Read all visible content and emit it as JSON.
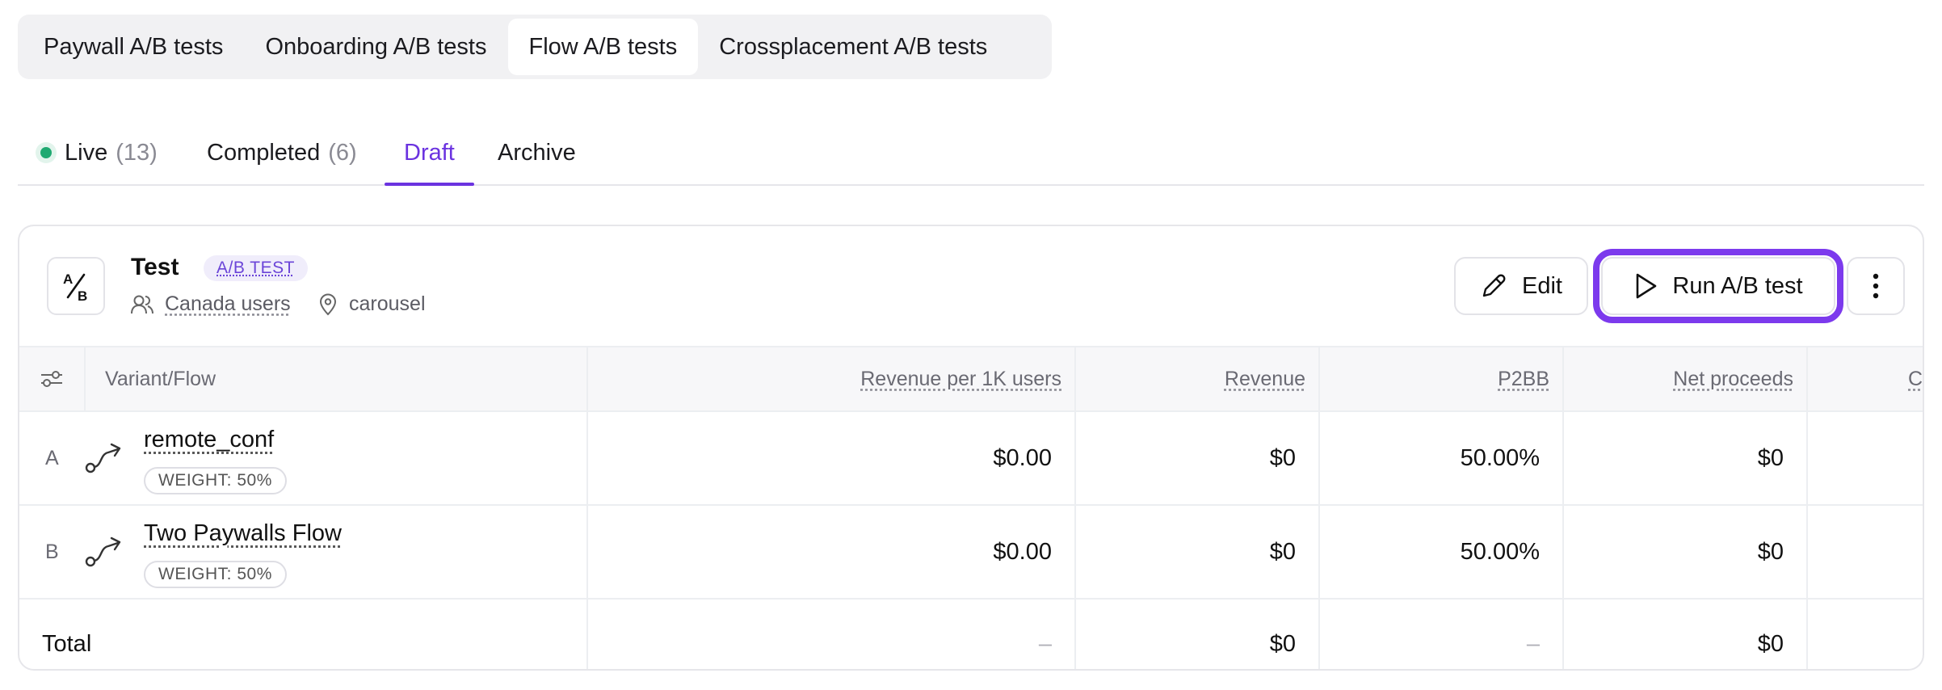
{
  "top_tabs": [
    {
      "label": "Paywall A/B tests"
    },
    {
      "label": "Onboarding A/B tests"
    },
    {
      "label": "Flow A/B tests",
      "active": true
    },
    {
      "label": "Crossplacement A/B tests"
    }
  ],
  "status_tabs": {
    "live": {
      "label": "Live",
      "count": "(13)"
    },
    "completed": {
      "label": "Completed",
      "count": "(6)"
    },
    "draft": {
      "label": "Draft"
    },
    "archive": {
      "label": "Archive"
    }
  },
  "test": {
    "badge_top": "A",
    "badge_bottom": "B",
    "title": "Test",
    "tag": "A/B TEST",
    "audience": "Canada users",
    "placement": "carousel",
    "edit_label": "Edit",
    "run_label": "Run A/B test"
  },
  "table": {
    "headers": {
      "variant": "Variant/Flow",
      "revenue_per_1k": "Revenue per 1K users",
      "revenue": "Revenue",
      "p2bb": "P2BB",
      "net_proceeds": "Net proceeds",
      "cr": "CR"
    },
    "rows": [
      {
        "letter": "A",
        "name": "remote_conf",
        "weight": "WEIGHT: 50%",
        "revenue_per_1k": "$0.00",
        "revenue": "$0",
        "p2bb": "50.00%",
        "net_proceeds": "$0"
      },
      {
        "letter": "B",
        "name": "Two Paywalls Flow",
        "weight": "WEIGHT: 50%",
        "revenue_per_1k": "$0.00",
        "revenue": "$0",
        "p2bb": "50.00%",
        "net_proceeds": "$0"
      }
    ],
    "total": {
      "label": "Total",
      "revenue_per_1k": "–",
      "revenue": "$0",
      "p2bb": "–",
      "net_proceeds": "$0"
    }
  },
  "colors": {
    "accent": "#6b33e0",
    "live": "#1fa971",
    "run_outline": "#7c3aed"
  }
}
